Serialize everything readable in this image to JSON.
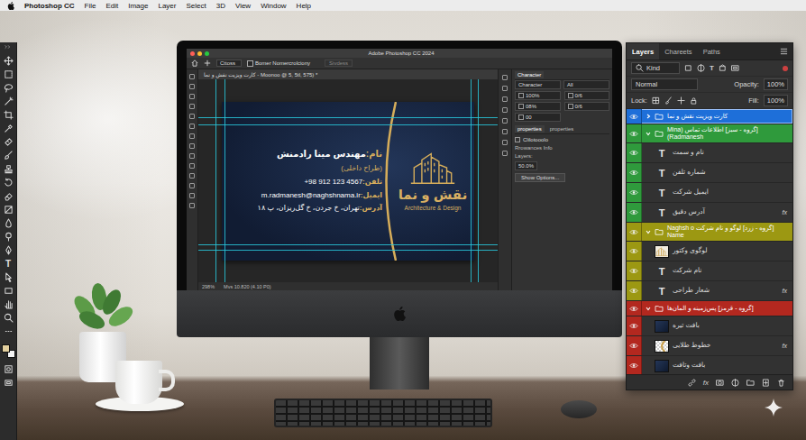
{
  "menu_bar": {
    "app_name": "Photoshop CC",
    "items": [
      "File",
      "Edit",
      "Image",
      "Layer",
      "Select",
      "3D",
      "View",
      "Window",
      "Help"
    ]
  },
  "tools_panel": {
    "type_tool": "T",
    "swatches": [
      {
        "color": "#e2cf9e"
      },
      {
        "color": "#f4f4f4"
      }
    ]
  },
  "monitor_screen": {
    "window_title": "Adobe Photoshop CC 2024",
    "options_bar": {
      "preset": "Cttoss",
      "checkbox_label": "Bomer Nomercrolciony",
      "checked": false,
      "button": "Sivdess"
    },
    "document_tab": "کارت ویزیت نقش و نما - Moonoo @ 5, 5tl, 575) *",
    "business_card": {
      "lines": [
        {
          "label": "نام:",
          "value": "مهندس مینا رادمنش",
          "kind": "name"
        },
        {
          "label": "",
          "value": "(طراح داخلی)",
          "kind": "subtitle"
        },
        {
          "label": "تلفن:",
          "value": "+98 912 123 4567",
          "kind": "detail"
        },
        {
          "label": "ایمیل:",
          "value": "m.radmanesh@naghshnama.ir",
          "kind": "detail"
        },
        {
          "label": "آدرس:",
          "value": "تهران، خ جردن، خ گل‌ریزان، پ ۱۸",
          "kind": "detail"
        }
      ],
      "brand": "نقش و نما",
      "tagline": "Architecture & Design"
    },
    "character_panel": {
      "title": "Character",
      "font": "Character",
      "style": "All",
      "fields": [
        "100%",
        "0/6",
        "08%",
        "0/6",
        "00"
      ]
    },
    "properties_panel": {
      "tabs": [
        {
          "label": "properties",
          "selected": true
        },
        {
          "label": "properties",
          "selected": false
        }
      ],
      "item": "Clilotooolo",
      "section": "Rrowances Info",
      "layers_label": "Layers:",
      "value": "50.0%",
      "button": "Show Options..."
    },
    "status_bar": {
      "zoom": "298%",
      "info": "Mvs 10.820 (4.10 P0)"
    }
  },
  "layers_panel": {
    "tabs": [
      {
        "label": "Layers",
        "selected": true
      },
      {
        "label": "Chareets",
        "selected": false
      },
      {
        "label": "Paths",
        "selected": false
      }
    ],
    "filter": "Kind",
    "blend_mode": "Normal",
    "opacity_label": "Opacity:",
    "opacity": "100%",
    "lock_label": "Lock:",
    "fill_label": "Fill:",
    "fill": "100%",
    "text_icon": "T",
    "footer_fx": "fx",
    "layers": [
      {
        "name": "کارت ویزیت نقش و نما",
        "kind": "group",
        "color": "#1e6fd9",
        "visible": true,
        "selected": true,
        "expanded": false,
        "badge": ""
      },
      {
        "name": "[گروه - سبز] اطلاعات تماس (Mina Radmanesh)",
        "kind": "group",
        "color": "#2f9a3c",
        "visible": true,
        "selected": false,
        "expanded": true,
        "badge": ""
      },
      {
        "name": "نام و سمت",
        "kind": "text",
        "color": "#2f9a3c",
        "visible": true,
        "selected": false,
        "badge": ""
      },
      {
        "name": "شماره تلفن",
        "kind": "text",
        "color": "#2f9a3c",
        "visible": true,
        "selected": false,
        "badge": ""
      },
      {
        "name": "ایمیل شرکت",
        "kind": "text",
        "color": "#2f9a3c",
        "visible": true,
        "selected": false,
        "badge": ""
      },
      {
        "name": "آدرس دقیق",
        "kind": "text",
        "color": "#2f9a3c",
        "visible": true,
        "selected": false,
        "badge": "fx"
      },
      {
        "name": "[گروه - زرد] لوگو و نام شرکت Naghsh o Name",
        "kind": "group",
        "color": "#9c9812",
        "visible": true,
        "selected": false,
        "expanded": true,
        "badge": ""
      },
      {
        "name": "لوگوی وکتور",
        "kind": "logo",
        "color": "#9c9812",
        "visible": true,
        "selected": false,
        "badge": ""
      },
      {
        "name": "نام شرکت",
        "kind": "text",
        "color": "#9c9812",
        "visible": true,
        "selected": false,
        "badge": ""
      },
      {
        "name": "شعار طراحی",
        "kind": "text",
        "color": "#9c9812",
        "visible": true,
        "selected": false,
        "badge": "fx"
      },
      {
        "name": "[گروه - قرمز] پس‌زمینه و المان‌ها",
        "kind": "group",
        "color": "#b3281f",
        "visible": true,
        "selected": false,
        "expanded": true,
        "badge": ""
      },
      {
        "name": "بافت تیره",
        "kind": "texture",
        "color": "#b3281f",
        "visible": true,
        "selected": false,
        "badge": ""
      },
      {
        "name": "خطوط طلایی",
        "kind": "lines",
        "color": "#b3281f",
        "visible": true,
        "selected": false,
        "badge": "fx"
      },
      {
        "name": "بافت وتافت",
        "kind": "texture",
        "color": "#b3281f",
        "visible": true,
        "selected": false,
        "badge": ""
      }
    ]
  }
}
